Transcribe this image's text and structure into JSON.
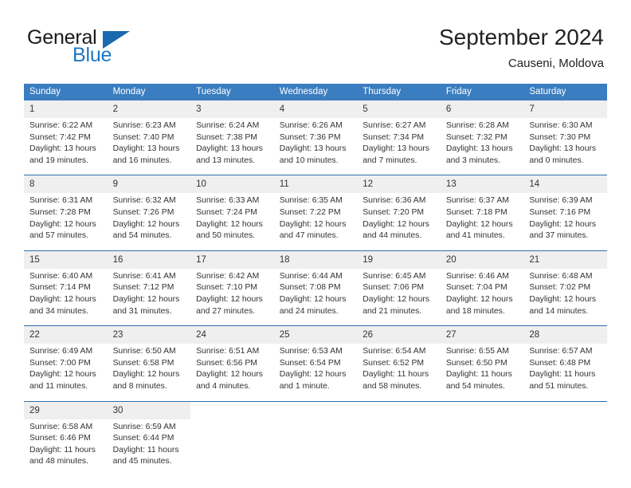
{
  "brand": {
    "line1": "General",
    "line2": "Blue",
    "triangle_color": "#1a69b0"
  },
  "header": {
    "title": "September 2024",
    "location": "Causeni, Moldova"
  },
  "colors": {
    "header_blue": "#3a7dc0",
    "week_separator_blue": "#2f6fae",
    "date_band_gray": "#efefef",
    "brand_blue": "#1f77c2",
    "text": "#333333"
  },
  "calendar": {
    "weekday_headers": [
      "Sunday",
      "Monday",
      "Tuesday",
      "Wednesday",
      "Thursday",
      "Friday",
      "Saturday"
    ],
    "weeks": [
      [
        {
          "day": "1",
          "lines": [
            "Sunrise: 6:22 AM",
            "Sunset: 7:42 PM",
            "Daylight: 13 hours",
            "and 19 minutes."
          ]
        },
        {
          "day": "2",
          "lines": [
            "Sunrise: 6:23 AM",
            "Sunset: 7:40 PM",
            "Daylight: 13 hours",
            "and 16 minutes."
          ]
        },
        {
          "day": "3",
          "lines": [
            "Sunrise: 6:24 AM",
            "Sunset: 7:38 PM",
            "Daylight: 13 hours",
            "and 13 minutes."
          ]
        },
        {
          "day": "4",
          "lines": [
            "Sunrise: 6:26 AM",
            "Sunset: 7:36 PM",
            "Daylight: 13 hours",
            "and 10 minutes."
          ]
        },
        {
          "day": "5",
          "lines": [
            "Sunrise: 6:27 AM",
            "Sunset: 7:34 PM",
            "Daylight: 13 hours",
            "and 7 minutes."
          ]
        },
        {
          "day": "6",
          "lines": [
            "Sunrise: 6:28 AM",
            "Sunset: 7:32 PM",
            "Daylight: 13 hours",
            "and 3 minutes."
          ]
        },
        {
          "day": "7",
          "lines": [
            "Sunrise: 6:30 AM",
            "Sunset: 7:30 PM",
            "Daylight: 13 hours",
            "and 0 minutes."
          ]
        }
      ],
      [
        {
          "day": "8",
          "lines": [
            "Sunrise: 6:31 AM",
            "Sunset: 7:28 PM",
            "Daylight: 12 hours",
            "and 57 minutes."
          ]
        },
        {
          "day": "9",
          "lines": [
            "Sunrise: 6:32 AM",
            "Sunset: 7:26 PM",
            "Daylight: 12 hours",
            "and 54 minutes."
          ]
        },
        {
          "day": "10",
          "lines": [
            "Sunrise: 6:33 AM",
            "Sunset: 7:24 PM",
            "Daylight: 12 hours",
            "and 50 minutes."
          ]
        },
        {
          "day": "11",
          "lines": [
            "Sunrise: 6:35 AM",
            "Sunset: 7:22 PM",
            "Daylight: 12 hours",
            "and 47 minutes."
          ]
        },
        {
          "day": "12",
          "lines": [
            "Sunrise: 6:36 AM",
            "Sunset: 7:20 PM",
            "Daylight: 12 hours",
            "and 44 minutes."
          ]
        },
        {
          "day": "13",
          "lines": [
            "Sunrise: 6:37 AM",
            "Sunset: 7:18 PM",
            "Daylight: 12 hours",
            "and 41 minutes."
          ]
        },
        {
          "day": "14",
          "lines": [
            "Sunrise: 6:39 AM",
            "Sunset: 7:16 PM",
            "Daylight: 12 hours",
            "and 37 minutes."
          ]
        }
      ],
      [
        {
          "day": "15",
          "lines": [
            "Sunrise: 6:40 AM",
            "Sunset: 7:14 PM",
            "Daylight: 12 hours",
            "and 34 minutes."
          ]
        },
        {
          "day": "16",
          "lines": [
            "Sunrise: 6:41 AM",
            "Sunset: 7:12 PM",
            "Daylight: 12 hours",
            "and 31 minutes."
          ]
        },
        {
          "day": "17",
          "lines": [
            "Sunrise: 6:42 AM",
            "Sunset: 7:10 PM",
            "Daylight: 12 hours",
            "and 27 minutes."
          ]
        },
        {
          "day": "18",
          "lines": [
            "Sunrise: 6:44 AM",
            "Sunset: 7:08 PM",
            "Daylight: 12 hours",
            "and 24 minutes."
          ]
        },
        {
          "day": "19",
          "lines": [
            "Sunrise: 6:45 AM",
            "Sunset: 7:06 PM",
            "Daylight: 12 hours",
            "and 21 minutes."
          ]
        },
        {
          "day": "20",
          "lines": [
            "Sunrise: 6:46 AM",
            "Sunset: 7:04 PM",
            "Daylight: 12 hours",
            "and 18 minutes."
          ]
        },
        {
          "day": "21",
          "lines": [
            "Sunrise: 6:48 AM",
            "Sunset: 7:02 PM",
            "Daylight: 12 hours",
            "and 14 minutes."
          ]
        }
      ],
      [
        {
          "day": "22",
          "lines": [
            "Sunrise: 6:49 AM",
            "Sunset: 7:00 PM",
            "Daylight: 12 hours",
            "and 11 minutes."
          ]
        },
        {
          "day": "23",
          "lines": [
            "Sunrise: 6:50 AM",
            "Sunset: 6:58 PM",
            "Daylight: 12 hours",
            "and 8 minutes."
          ]
        },
        {
          "day": "24",
          "lines": [
            "Sunrise: 6:51 AM",
            "Sunset: 6:56 PM",
            "Daylight: 12 hours",
            "and 4 minutes."
          ]
        },
        {
          "day": "25",
          "lines": [
            "Sunrise: 6:53 AM",
            "Sunset: 6:54 PM",
            "Daylight: 12 hours",
            "and 1 minute."
          ]
        },
        {
          "day": "26",
          "lines": [
            "Sunrise: 6:54 AM",
            "Sunset: 6:52 PM",
            "Daylight: 11 hours",
            "and 58 minutes."
          ]
        },
        {
          "day": "27",
          "lines": [
            "Sunrise: 6:55 AM",
            "Sunset: 6:50 PM",
            "Daylight: 11 hours",
            "and 54 minutes."
          ]
        },
        {
          "day": "28",
          "lines": [
            "Sunrise: 6:57 AM",
            "Sunset: 6:48 PM",
            "Daylight: 11 hours",
            "and 51 minutes."
          ]
        }
      ],
      [
        {
          "day": "29",
          "lines": [
            "Sunrise: 6:58 AM",
            "Sunset: 6:46 PM",
            "Daylight: 11 hours",
            "and 48 minutes."
          ]
        },
        {
          "day": "30",
          "lines": [
            "Sunrise: 6:59 AM",
            "Sunset: 6:44 PM",
            "Daylight: 11 hours",
            "and 45 minutes."
          ]
        },
        {
          "day": "",
          "lines": []
        },
        {
          "day": "",
          "lines": []
        },
        {
          "day": "",
          "lines": []
        },
        {
          "day": "",
          "lines": []
        },
        {
          "day": "",
          "lines": []
        }
      ]
    ]
  }
}
